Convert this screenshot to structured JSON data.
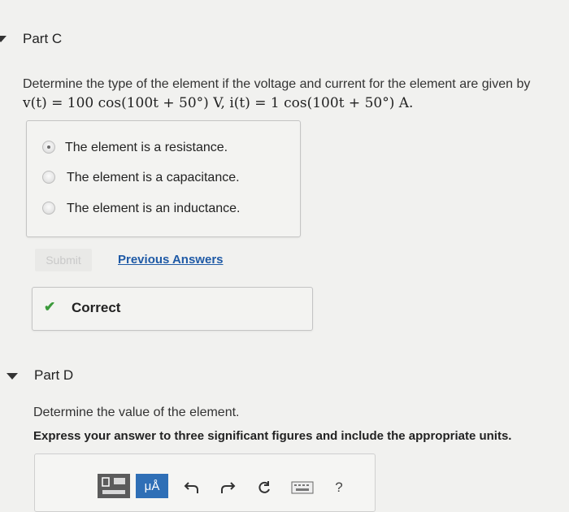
{
  "part_c": {
    "title": "Part C",
    "question_text": "Determine the type of the element if the voltage and current for the element are given by",
    "equation": "v(t) = 100 cos(100t + 50°) V, i(t) = 1 cos(100t + 50°) A.",
    "options": [
      {
        "label": "The element is a resistance.",
        "selected": true
      },
      {
        "label": "The element is a capacitance.",
        "selected": false
      },
      {
        "label": "The element is an inductance.",
        "selected": false
      }
    ],
    "submit_label": "Submit",
    "previous_answers_label": "Previous Answers",
    "feedback_label": "Correct"
  },
  "part_d": {
    "title": "Part D",
    "question_text": "Determine the value of the element.",
    "instruction": "Express your answer to three significant figures and include the appropriate units.",
    "toolbar": {
      "templates_icon": "templates-icon",
      "units_label": "μÅ",
      "undo_icon": "undo-icon",
      "redo_icon": "redo-icon",
      "reset_icon": "reset-icon",
      "keyboard_icon": "keyboard-icon",
      "help_label": "?"
    }
  },
  "colors": {
    "background": "#f1f1ef",
    "link": "#1f5aa6",
    "check": "#3b9a3b",
    "units_button": "#2f6fb6"
  }
}
